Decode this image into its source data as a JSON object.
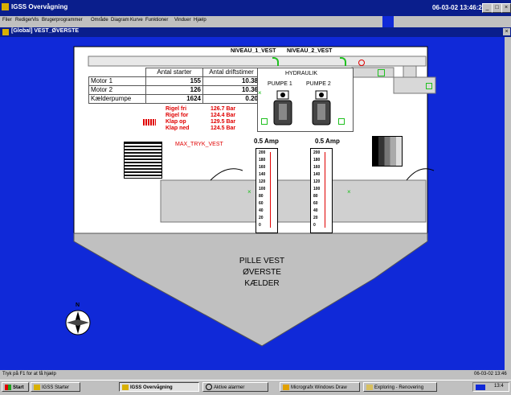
{
  "window": {
    "title": "IGSS Overvågning",
    "datetime": "06-03-02  13:46:27",
    "inner_title": "[Global] VEST_ØVERSTE"
  },
  "menu": [
    "Filer",
    "Rediger",
    "Vis",
    "Brugerprogrammer",
    "Område",
    "Diagram",
    "Kurve",
    "Funktioner",
    "Vinduer",
    "Hjælp"
  ],
  "diagram": {
    "levels": [
      "NIVEAU_1_VEST",
      "NIVEAU_2_VEST"
    ],
    "table": {
      "headers": [
        "",
        "Antal starter",
        "Antal driftstimer"
      ],
      "rows": [
        [
          "Motor 1",
          "155",
          "10.38"
        ],
        [
          "Motor 2",
          "126",
          "10.36"
        ],
        [
          "Kælderpumpe",
          "1624",
          "0.20"
        ]
      ]
    },
    "alarms": [
      {
        "label": "Rigel fri",
        "value": "126.7 Bar"
      },
      {
        "label": "Rigel for",
        "value": "124.4 Bar"
      },
      {
        "label": "Klap op",
        "value": "129.5 Bar"
      },
      {
        "label": "Klap ned",
        "value": "124.5 Bar"
      }
    ],
    "max_label": "MAX_TRYK_VEST",
    "hydraulik": {
      "title": "HYDRAULIK",
      "pump1": "PUMPE 1",
      "pump2": "PUMPE 2"
    },
    "gauges": [
      {
        "label": "0.5 Amp",
        "ticks": [
          "200",
          "180",
          "160",
          "140",
          "120",
          "100",
          "80",
          "60",
          "40",
          "20",
          "0"
        ]
      },
      {
        "label": "0.5 Amp",
        "ticks": [
          "200",
          "180",
          "160",
          "140",
          "120",
          "100",
          "80",
          "60",
          "40",
          "20",
          "0"
        ]
      }
    ],
    "pile_label": [
      "PILLE VEST",
      "ØVERSTE",
      "KÆLDER"
    ],
    "compass_letter": "N"
  },
  "status": {
    "hint": "Tryk på F1 for at få hjælp",
    "date": "06-03-02  13:46"
  },
  "taskbar": {
    "start": "Start",
    "tasks": [
      "IGSS Starter",
      "IGSS Overvågning",
      "Aktive alarmer",
      "Micrografx Windows Draw",
      "Exploring - Renovering"
    ],
    "clock": "13:4"
  },
  "colors": {
    "canvas": "#1029d8",
    "alarm_red": "#e00000",
    "titlebar": "#0a1e8c"
  }
}
